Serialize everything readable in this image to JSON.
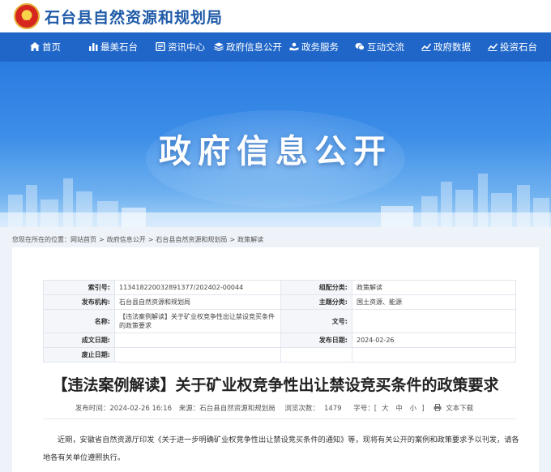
{
  "header": {
    "site_title": "石台县自然资源和规划局",
    "emblem_icon": "national-emblem-icon"
  },
  "nav": {
    "items": [
      {
        "label": "首页",
        "icon": "home-icon"
      },
      {
        "label": "最美石台",
        "icon": "bar-icon"
      },
      {
        "label": "资讯中心",
        "icon": "news-icon"
      },
      {
        "label": "政府信息公开",
        "icon": "layers-icon"
      },
      {
        "label": "政务服务",
        "icon": "hand-icon"
      },
      {
        "label": "互动交流",
        "icon": "chat-icon"
      },
      {
        "label": "政府数据",
        "icon": "chart-icon"
      },
      {
        "label": "投资石台",
        "icon": "chart-icon"
      }
    ]
  },
  "banner": {
    "title": "政府信息公开"
  },
  "breadcrumb": {
    "prefix": "您现在所在的位置：",
    "items": [
      "网站首页",
      "政府信息公开",
      "石台县自然资源和规划局",
      "政策解读"
    ],
    "separator": ">"
  },
  "meta": {
    "index_label": "索引号:",
    "index_value": "11341822003289137​7/202402-00044",
    "category_label": "组配分类:",
    "category_value": "政策解读",
    "org_label": "发布机构:",
    "org_value": "石台县自然资源和规划局",
    "topic_label": "主题分类:",
    "topic_value": "国土资源、能源",
    "name_label": "名称:",
    "name_value": "【违法案例解读】关于矿业权竞争性出让禁设竞买条件的政策要求",
    "docno_label": "文号:",
    "docno_value": "",
    "created_label": "成文日期:",
    "created_value": "",
    "published_label": "发布日期:",
    "published_value": "2024-02-26",
    "abolish_label": "废止日期:",
    "abolish_value": ""
  },
  "article": {
    "title": "【违法案例解读】关于矿业权竞争性出让禁设竞买条件的政策要求",
    "publish_time": "发布时间：2024-02-26 16:16",
    "source": "来源：石台县自然资源和规划局",
    "views_label": "浏览次数：",
    "views": "1479",
    "font_label": "字号：[",
    "font_large": "大",
    "font_medium": "中",
    "font_small": "小",
    "font_end": "]",
    "download_label": "文本下载",
    "body": "近期，安徽省自然资源厅印发《关于进一步明确矿业权竞争性出让禁设竞买条件的通知》等，现将有关公开的案例和政策要求予以刊发，请各地各有关单位遵照执行。"
  },
  "colors": {
    "nav_bg": "#1f66c8",
    "title_blue": "#1e5aa8",
    "page_bg": "#eef3f9"
  }
}
